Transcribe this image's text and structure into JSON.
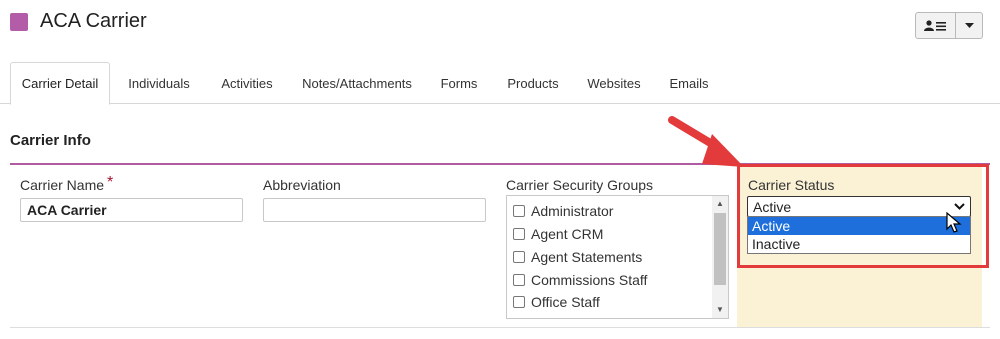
{
  "header": {
    "title": "ACA Carrier",
    "color": "#b35ca8"
  },
  "tabs": [
    {
      "label": "Carrier Detail",
      "active": true
    },
    {
      "label": "Individuals"
    },
    {
      "label": "Activities"
    },
    {
      "label": "Notes/Attachments"
    },
    {
      "label": "Forms"
    },
    {
      "label": "Products"
    },
    {
      "label": "Websites"
    },
    {
      "label": "Emails"
    }
  ],
  "section": {
    "title": "Carrier Info"
  },
  "fields": {
    "carrier_name": {
      "label": "Carrier Name",
      "required_mark": "*",
      "value": "ACA Carrier"
    },
    "abbreviation": {
      "label": "Abbreviation",
      "value": ""
    },
    "security_groups": {
      "label": "Carrier Security Groups",
      "options": [
        "Administrator",
        "Agent CRM",
        "Agent Statements",
        "Commissions Staff",
        "Office Staff"
      ]
    },
    "carrier_status": {
      "label": "Carrier Status",
      "value": "Active",
      "options": [
        "Active",
        "Inactive"
      ],
      "highlighted_option": "Active"
    }
  },
  "icons": {
    "contact_menu": "contact-list-icon",
    "caret": "caret-down-icon",
    "annotation_arrow": "red-arrow-icon",
    "cursor": "mouse-cursor-icon"
  },
  "colors": {
    "accent_line": "#b05ca0",
    "highlight": "#e33b3b",
    "panel": "#fbf2d6",
    "selection": "#1e6fdc"
  }
}
